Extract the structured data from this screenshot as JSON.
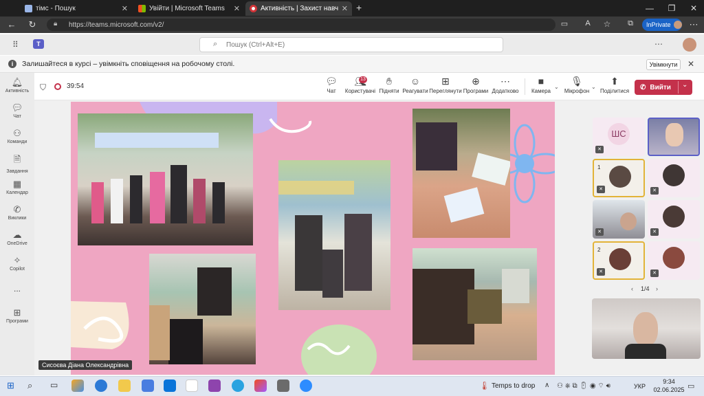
{
  "browser": {
    "tabs": [
      {
        "label": "тімс - Пошук"
      },
      {
        "label": "Увійти | Microsoft Teams"
      },
      {
        "label": "Активність | Захист навчаль"
      }
    ],
    "url": "https://teams.microsoft.com/v2/",
    "inprivate_label": "InPrivate"
  },
  "teams": {
    "search_placeholder": "Пошук (Ctrl+Alt+E)",
    "notification": "Залишайтеся в курсі – увімкніть сповіщення на робочому столі.",
    "enable_label": "Увімкнути",
    "rail": [
      {
        "label": "Активність",
        "icon": "bell-icon"
      },
      {
        "label": "Чат",
        "icon": "chat-icon"
      },
      {
        "label": "Команди",
        "icon": "teams-icon"
      },
      {
        "label": "Завдання",
        "icon": "assignments-icon"
      },
      {
        "label": "Календар",
        "icon": "calendar-icon"
      },
      {
        "label": "Виклики",
        "icon": "phone-icon"
      },
      {
        "label": "OneDrive",
        "icon": "cloud-icon"
      },
      {
        "label": "Copilot",
        "icon": "copilot-icon"
      },
      {
        "label": "...",
        "icon": "more-icon"
      },
      {
        "label": "Програми",
        "icon": "apps-icon"
      }
    ]
  },
  "meeting": {
    "timer": "39:54",
    "toolbar": {
      "chat": "Чат",
      "people": "Користувачі",
      "people_count": "13",
      "raise": "Підняти",
      "react": "Реагувати",
      "view": "Переглянути",
      "apps": "Програми",
      "more": "Додатково",
      "camera": "Камера",
      "mic": "Мікрофон",
      "share": "Поділитися",
      "leave": "Вийти"
    },
    "presenter_name": "Сисоєва Діана Олександрівна",
    "roster_initials": "ШС",
    "pinned_badges": [
      "1",
      "2"
    ],
    "pager": "1/4"
  },
  "taskbar": {
    "weather": "Temps to drop",
    "lang": "УКР",
    "time": "9:34",
    "date": "02.06.2025"
  },
  "colors": {
    "teams_purple": "#5b5fc7",
    "leave_red": "#c4314b",
    "slide_pink": "#efa6c2",
    "blob_lilac": "#c9b6f0",
    "blob_green": "#c9e2b4",
    "flower_blue": "#7fb6f0"
  }
}
